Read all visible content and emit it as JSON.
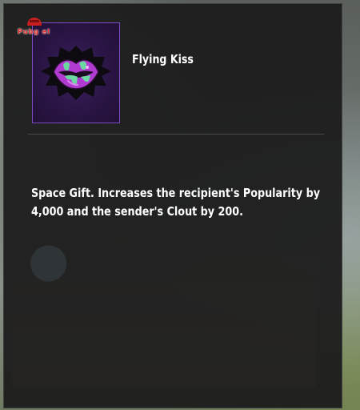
{
  "item": {
    "name": "Flying Kiss",
    "description": "Space Gift. Increases the recipient's Popularity by 4,000 and the sender's Clout by 200.",
    "icon": "lips-icon",
    "frame_color": "#7b4bc4",
    "lips_color": "#b13bd1",
    "drip_color": "#6ad8a0"
  },
  "watermark": {
    "label": "Pubg el",
    "color": "#e02828"
  }
}
